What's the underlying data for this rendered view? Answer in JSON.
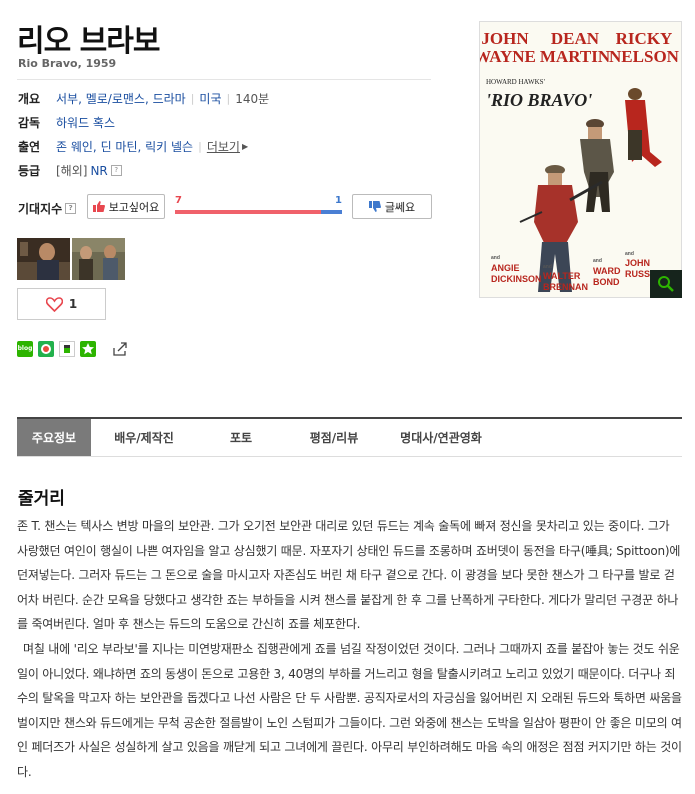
{
  "movie": {
    "title": "리오 브라보",
    "subtitle": "Rio Bravo, 1959"
  },
  "info": {
    "overview_label": "개요",
    "genres": "서부, 멜로/로맨스, 드라마",
    "country": "미국",
    "runtime": "140분",
    "director_label": "감독",
    "director": "하워드 혹스",
    "cast_label": "출연",
    "cast": "존 웨인, 딘 마틴, 릭키 넬슨",
    "more_label": "더보기",
    "rating_label": "등급",
    "rating_region": "[해외]",
    "rating": "NR",
    "help": "?"
  },
  "expectation": {
    "label": "기대지수",
    "want_label": "보고싶어요",
    "want_count": "7",
    "nope_label": "글쎄요",
    "nope_count": "1",
    "want_fraction": 0.875
  },
  "like": {
    "count": "1"
  },
  "poster": {
    "line1": [
      "JOHN",
      "WAYNE"
    ],
    "line2": [
      "DEAN",
      "MARTIN"
    ],
    "line3": [
      "RICKY",
      "NELSON"
    ],
    "presenter": "HOWARD HAWKS'",
    "film": "'RIO BRAVO'",
    "bottom": [
      {
        "and": "and",
        "name1": "ANGIE",
        "name2": "DICKINSON"
      },
      {
        "and": "and",
        "name1": "WALTER",
        "name2": "BRENNAN"
      },
      {
        "and": "and",
        "name1": "WARD",
        "name2": "BOND"
      },
      {
        "and": "and",
        "name1": "JOHN",
        "name2": "RUSSELL"
      }
    ]
  },
  "tabs": [
    "주요정보",
    "배우/제작진",
    "포토",
    "평점/리뷰",
    "명대사/연관영화"
  ],
  "synopsis": {
    "heading": "줄거리",
    "paragraphs": [
      "존 T. 챈스는 텍사스 변방 마을의 보안관. 그가 오기전 보안관 대리로 있던 듀드는 계속 술독에 빠져 정신을 못차리고 있는 중이다. 그가 사랑했던 여인이 행실이 나쁜 여자임을 알고 상심했기 때문. 자포자기 상태인 듀드를 조롱하며 죠버뎃이 동전을 타구(唾具; Spittoon)에 던져넣는다. 그러자 듀드는 그 돈으로 술을 마시고자 자존심도 버린 채 타구 곁으로 간다. 이 광경을 보다 못한 챈스가 그 타구를 발로 걷어차 버린다. 순간 모욕을 당했다고 생각한 죠는 부하들을 시켜 챈스를 붙잡게 한 후 그를 난폭하게 구타한다. 게다가 말리던 구경꾼 하나를 죽여버린다. 얼마 후 챈스는 듀드의 도움으로 간신히 죠를 체포한다.",
      "며칠 내에 '리오 부라보'를 지나는 미연방재판소 집행관에게 죠를 넘길 작정이었던 것이다. 그러나 그때까지 죠를 붙잡아 놓는 것도 쉬운 일이 아니었다. 왜냐하면 죠의 동생이 돈으로 고용한 3, 40명의 부하를 거느리고 형을 탈출시키려고 노리고 있었기 때문이다. 더구나 죄수의 탈옥을 막고자 하는 보안관을 돕겠다고 나선 사람은 단 두 사람뿐. 공직자로서의 자긍심을 잃어버린 지 오래된 듀드와 툭하면 싸움을 벌이지만 챈스와 듀드에게는 무척 공손한 절름발이 노인 스텀피가 그들이다. 그런 와중에 챈스는 도박을 일삼아 평판이 안 좋은 미모의 여인 페더즈가 사실은 성실하게 살고 있음을 깨닫게 되고 그녀에게 끌린다. 아무리 부인하려해도 마음 속의 애정은 점점 커지기만 하는 것이다."
    ]
  },
  "colors": {
    "link": "#1a4ea0",
    "want_bar": "#f0616b",
    "nope_bar": "#4a7fd4",
    "want_icon": "#e8474f",
    "nope_icon": "#3d78cc",
    "tab_active": "#7a7a7a",
    "poster_red": "#b8261e"
  }
}
